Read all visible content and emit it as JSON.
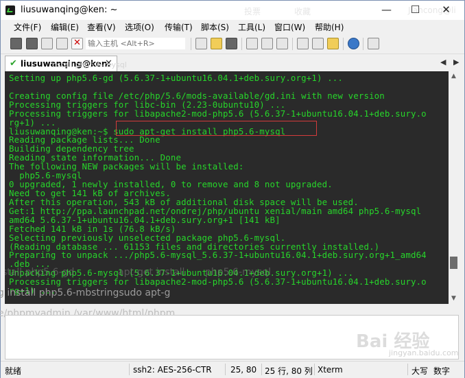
{
  "window": {
    "title": "liusuwanqing@ken: ~",
    "ghost_title": [
      "投票",
      "收藏",
      "Jiancong@li"
    ],
    "controls": {
      "minimize": "—",
      "maximize": "☐",
      "close": "✕"
    }
  },
  "menu": {
    "items": [
      "文件(F)",
      "编辑(E)",
      "查看(V)",
      "选项(O)",
      "传输(T)",
      "脚本(S)",
      "工具(L)",
      "窗口(W)",
      "帮助(H)"
    ]
  },
  "toolbar": {
    "host_placeholder": "输入主机 <Alt+R>",
    "icons": [
      "connect-icon",
      "quick-connect-icon",
      "connect-tab-icon",
      "reconnect-icon",
      "disconnect-icon",
      "copy-icon",
      "paste-icon",
      "find-icon",
      "print-setup-icon",
      "print-icon",
      "print-screen-icon",
      "session-options-icon",
      "global-options-icon",
      "key-icon",
      "help-icon",
      "map-icon"
    ]
  },
  "tab": {
    "label": "liusuwanqing@ken: ~",
    "status_icon": "connected-check-icon",
    "close_glyph": "✕",
    "ghost_text": "nstall php5.6-mysql",
    "nav_left": "◀",
    "nav_right": "▶"
  },
  "terminal": {
    "text_color": "#27d62a",
    "background": "#2a2a2a",
    "highlight_color": "#d43c3c",
    "lines": [
      "Setting up php5.6-gd (5.6.37-1+ubuntu16.04.1+deb.sury.org+1) ...",
      "",
      "Creating config file /etc/php/5.6/mods-available/gd.ini with new version",
      "Processing triggers for libc-bin (2.23-0ubuntu10) ...",
      "Processing triggers for libapache2-mod-php5.6 (5.6.37-1+ubuntu16.04.1+deb.sury.o",
      "rg+1) ...",
      "liusuwanqing@ken:~$ sudo apt-get install php5.6-mysql",
      "Reading package lists... Done",
      "Building dependency tree",
      "Reading state information... Done",
      "The following NEW packages will be installed:",
      "  php5.6-mysql",
      "0 upgraded, 1 newly installed, 0 to remove and 8 not upgraded.",
      "Need to get 141 kB of archives.",
      "After this operation, 543 kB of additional disk space will be used.",
      "Get:1 http://ppa.launchpad.net/ondrej/php/ubuntu xenial/main amd64 php5.6-mysql",
      "amd64 5.6.37-1+ubuntu16.04.1+deb.sury.org+1 [141 kB]",
      "Fetched 141 kB in 1s (76.8 kB/s)",
      "Selecting previously unselected package php5.6-mysql.",
      "(Reading database ... 61153 files and directories currently installed.)",
      "Preparing to unpack .../php5.6-mysql_5.6.37-1+ubuntu16.04.1+deb.sury.org+1_amd64",
      ".deb ...",
      "Unpacking php5.6-mysql (5.6.37-1+ubuntu16.04.1+deb.sury.org+1) ...",
      "Processing triggers for libapache2-mod-php5.6 (5.6.37-1+ubuntu16.04.1+deb.sury.o",
      "rg+1) ..."
    ],
    "ghost_overlay": [
      "stall php5.6-gd",
      "apt-get install",
      "php5.6-mysql"
    ]
  },
  "ghost_compose": {
    "line1": "g install php5.6-mbstringsudo  apt-g",
    "line2": "e/phpmyadmin  /var/www/html/phpm"
  },
  "statusbar": {
    "ready": "就绪",
    "cipher": "ssh2: AES-256-CTR",
    "cursor": "25,  80",
    "rows_cols": "25 行, 80 列",
    "term_type": "Xterm",
    "caps": "大写",
    "num": "数字"
  },
  "watermark": {
    "logo": "Bai 经验",
    "sub": "jingyan.baidu.com"
  }
}
